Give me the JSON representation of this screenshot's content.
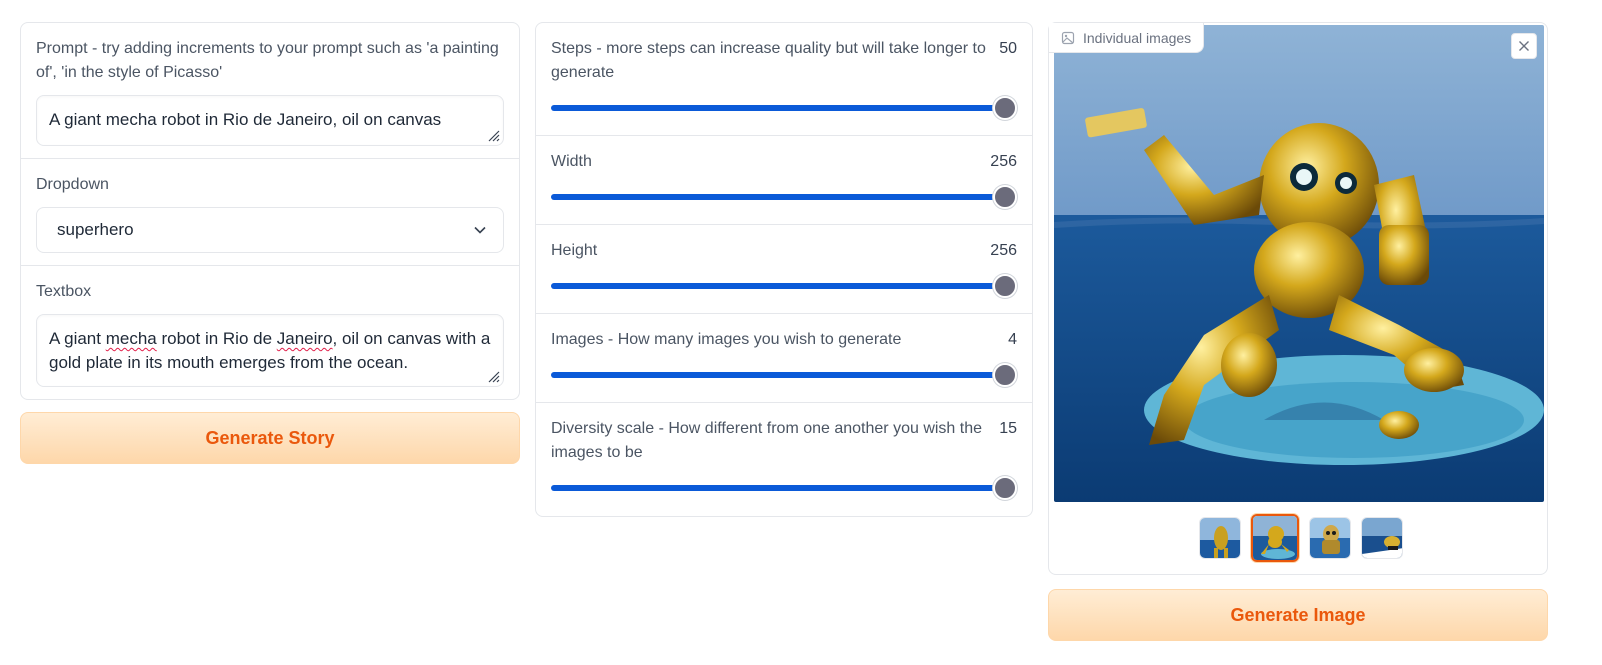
{
  "left": {
    "prompt_label": "Prompt - try adding increments to your prompt such as 'a painting of', 'in the style of Picasso'",
    "prompt_value": "A giant mecha robot in Rio de Janeiro, oil on canvas",
    "dropdown_label": "Dropdown",
    "dropdown_value": "superhero",
    "textbox_label": "Textbox",
    "textbox_parts": [
      "A giant ",
      "mecha",
      " robot in Rio de ",
      "Janeiro",
      ", oil on canvas with a gold plate in its mouth emerges from the ocean."
    ],
    "generate_story_label": "Generate Story"
  },
  "sliders": [
    {
      "label": "Steps - more steps can increase quality but will take longer to generate",
      "value": "50",
      "fill": 1.0
    },
    {
      "label": "Width",
      "value": "256",
      "fill": 1.0
    },
    {
      "label": "Height",
      "value": "256",
      "fill": 1.0
    },
    {
      "label": "Images - How many images you wish to generate",
      "value": "4",
      "fill": 1.0
    },
    {
      "label": "Diversity scale - How different from one another you wish the images to be",
      "value": "15",
      "fill": 1.0
    }
  ],
  "gallery": {
    "label": "Individual images",
    "selected_index": 1,
    "thumbnail_count": 4,
    "generate_image_label": "Generate Image"
  },
  "colors": {
    "accent_orange": "#ea580c",
    "slider_blue": "#0b5ad8",
    "thumb_gray": "#6b6b7b"
  }
}
